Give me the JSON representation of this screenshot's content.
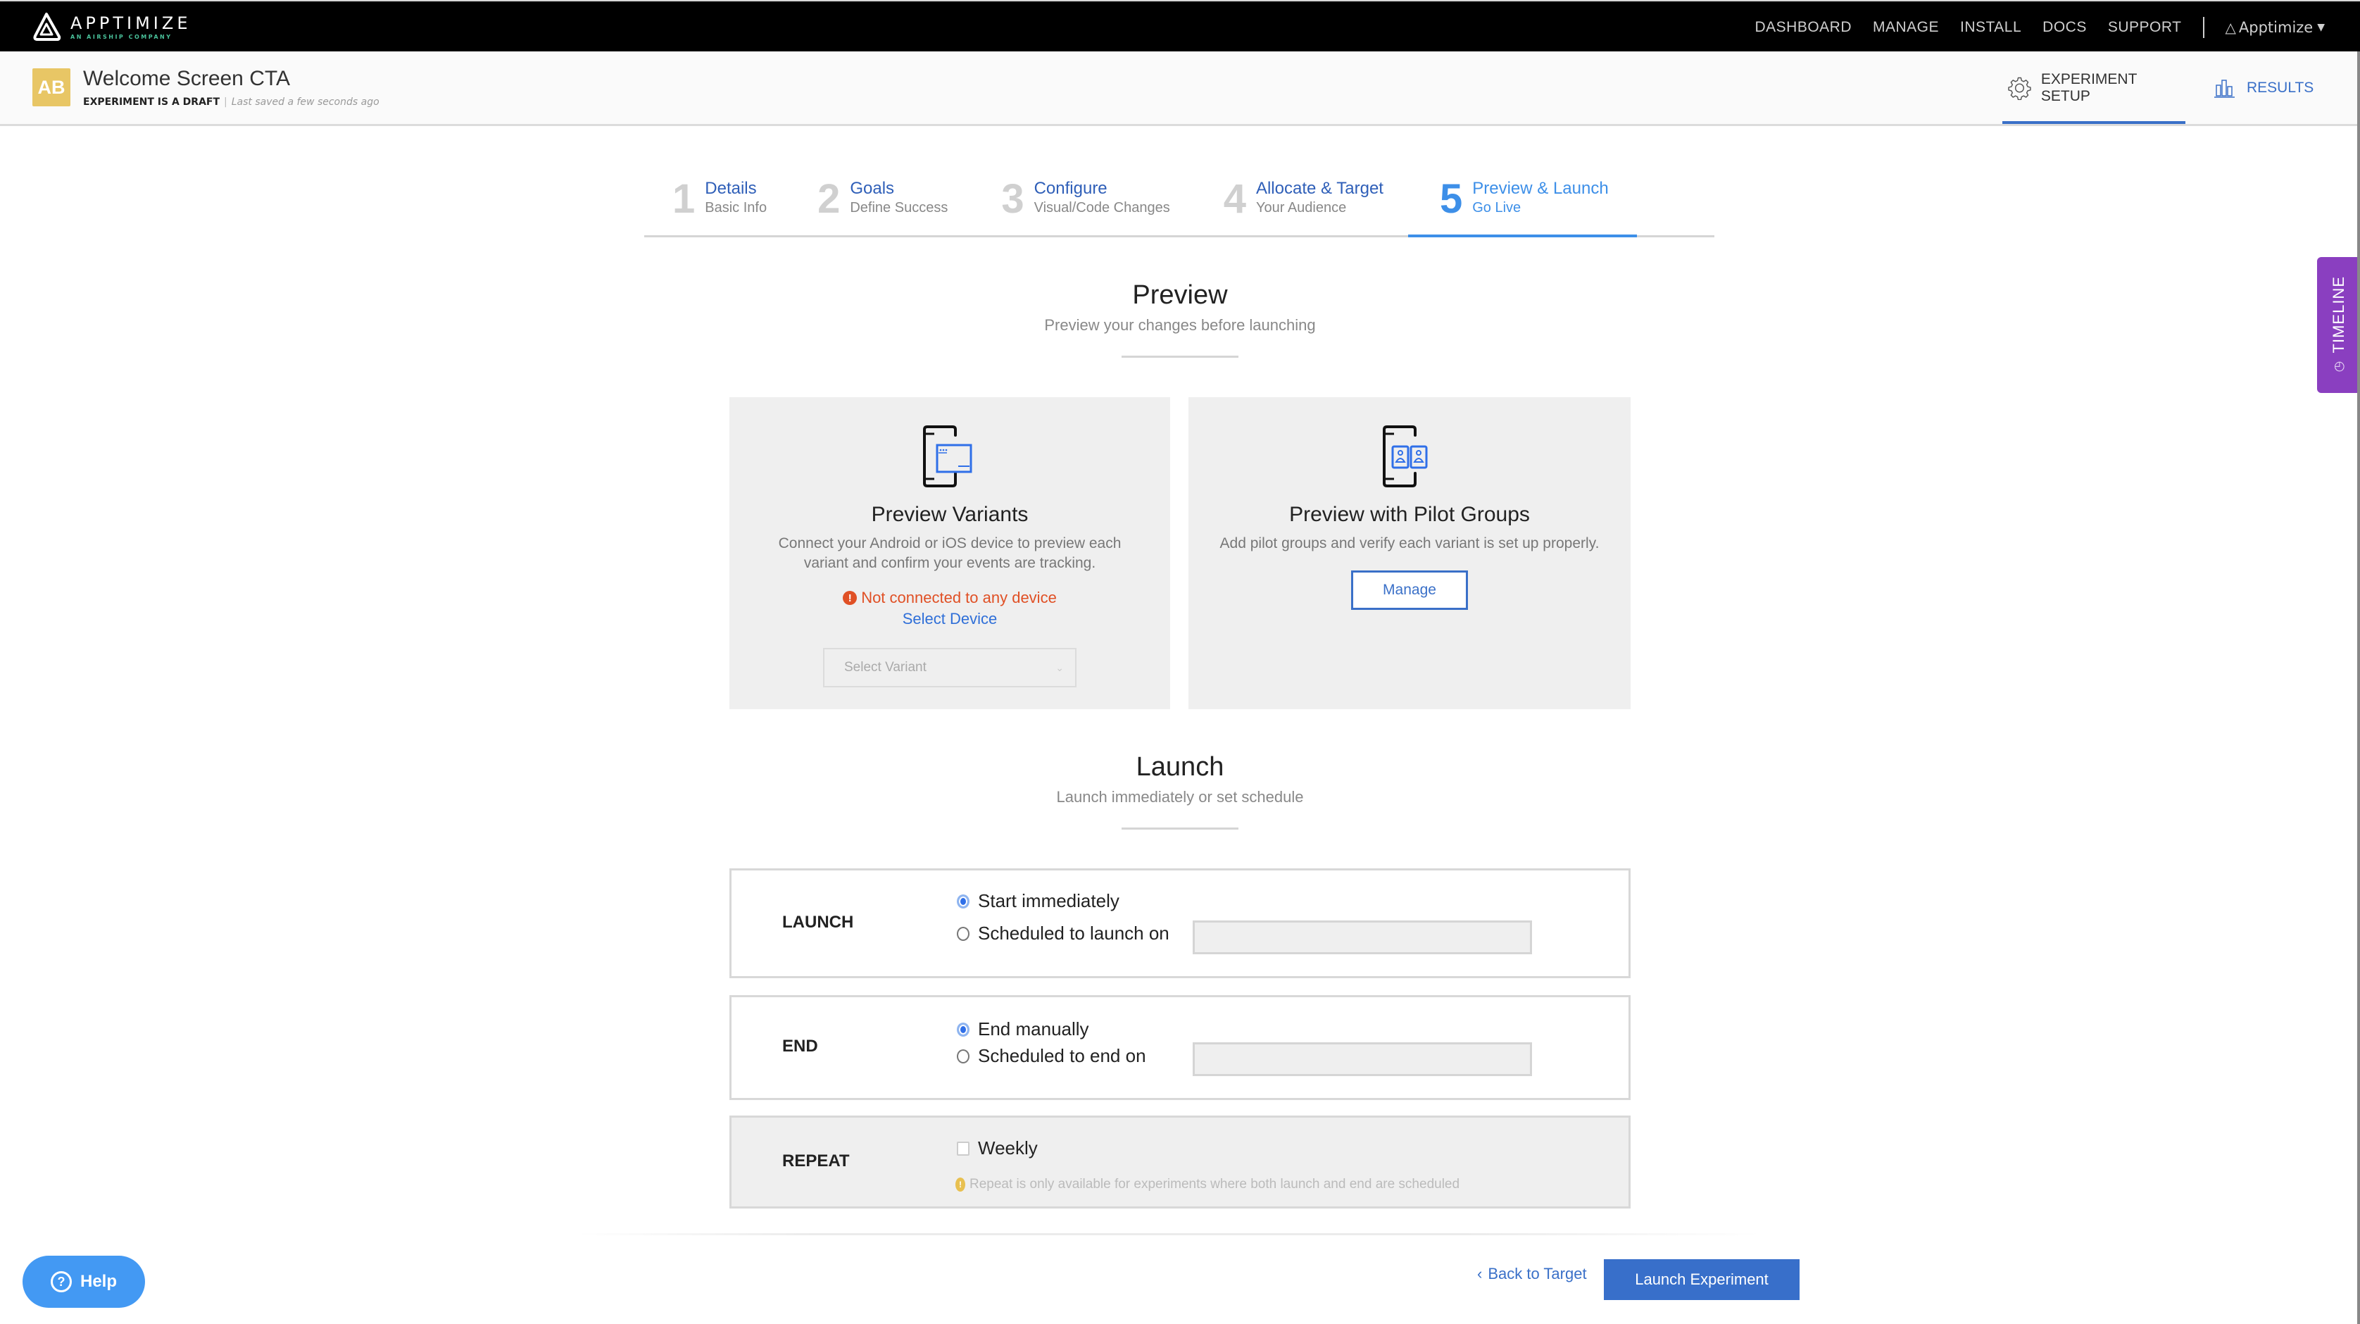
{
  "brand": {
    "name": "APPTIMIZE",
    "tagline": "AN AIRSHIP COMPANY"
  },
  "topnav": {
    "links": [
      "DASHBOARD",
      "MANAGE",
      "INSTALL",
      "DOCS",
      "SUPPORT"
    ],
    "account_label": "Apptimize"
  },
  "experiment": {
    "badge": "AB",
    "title": "Welcome Screen CTA",
    "status": "EXPERIMENT IS A DRAFT",
    "saved": "Last saved a few seconds ago"
  },
  "header_tabs": {
    "setup": "EXPERIMENT SETUP",
    "results": "RESULTS"
  },
  "stepper": {
    "active_step": 5,
    "steps": [
      {
        "num": "1",
        "title": "Details",
        "sub": "Basic Info"
      },
      {
        "num": "2",
        "title": "Goals",
        "sub": "Define Success"
      },
      {
        "num": "3",
        "title": "Configure",
        "sub": "Visual/Code Changes"
      },
      {
        "num": "4",
        "title": "Allocate & Target",
        "sub": "Your Audience"
      },
      {
        "num": "5",
        "title": "Preview & Launch",
        "sub": "Go Live"
      }
    ]
  },
  "preview": {
    "title": "Preview",
    "subtitle": "Preview your changes before launching",
    "variants_card": {
      "title": "Preview Variants",
      "desc": "Connect your Android or iOS device to preview each variant and confirm your events are tracking.",
      "warning": "Not connected to any device",
      "select_device": "Select Device",
      "select_placeholder": "Select Variant"
    },
    "pilot_card": {
      "title": "Preview with Pilot Groups",
      "desc": "Add pilot groups and verify each variant is set up properly.",
      "button": "Manage"
    }
  },
  "launch": {
    "title": "Launch",
    "subtitle": "Launch immediately or set schedule",
    "launch_box": {
      "label": "LAUNCH",
      "options": [
        {
          "label": "Start immediately",
          "checked": true
        },
        {
          "label": "Scheduled to launch on",
          "checked": false
        }
      ],
      "date_value": ""
    },
    "end_box": {
      "label": "END",
      "options": [
        {
          "label": "End manually",
          "checked": true
        },
        {
          "label": "Scheduled to end on",
          "checked": false
        }
      ],
      "date_value": ""
    },
    "repeat_box": {
      "label": "REPEAT",
      "checkbox_label": "Weekly",
      "checked": false,
      "note": "Repeat is only available for experiments where both launch and end are scheduled"
    }
  },
  "footer": {
    "back": "Back to Target",
    "launch": "Launch Experiment"
  },
  "help": {
    "label": "Help"
  },
  "timeline": {
    "label": "TIMELINE"
  },
  "colors": {
    "brand_blue": "#3a70c8",
    "active_step": "#3d8fe8",
    "warning": "#e05025",
    "timeline": "#8a3fc0",
    "help": "#4399f3",
    "badge": "#e8c665"
  }
}
